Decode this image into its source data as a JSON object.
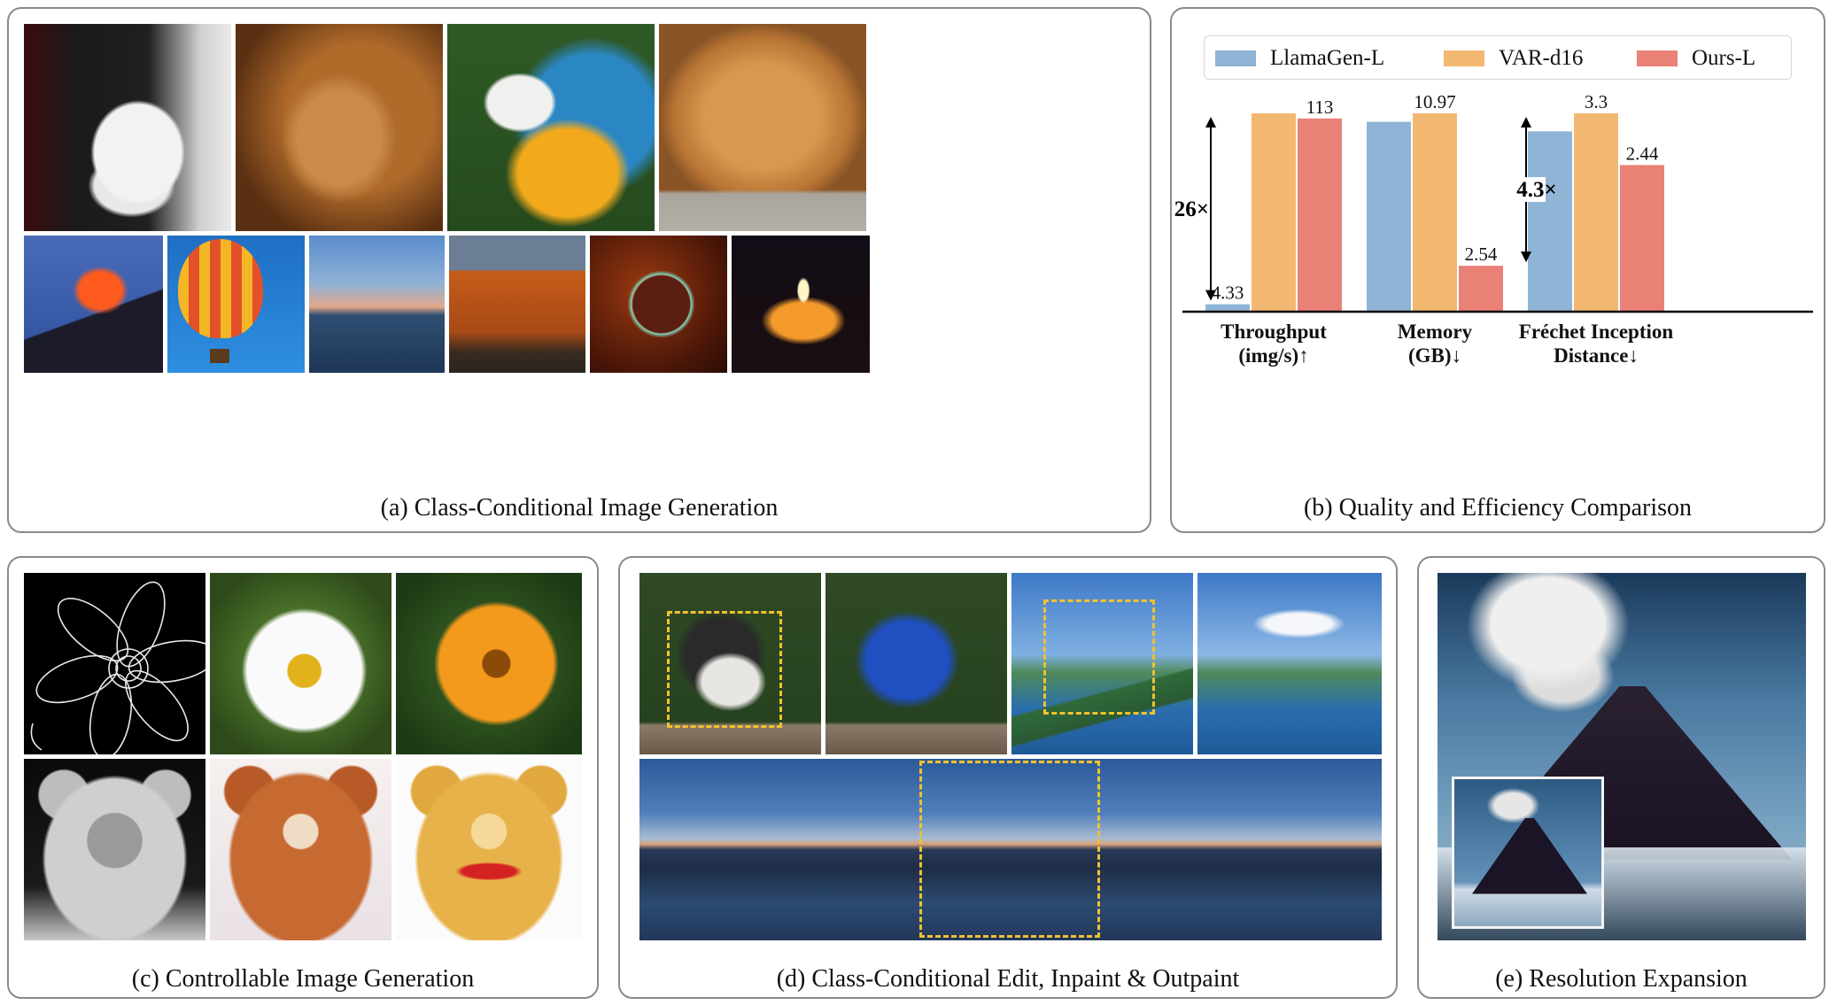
{
  "panels": {
    "a": {
      "caption": "(a) Class-Conditional Image Generation"
    },
    "b": {
      "caption": "(b) Quality and Efficiency Comparison"
    },
    "c": {
      "caption": "(c) Controllable Image Generation"
    },
    "d": {
      "caption": "(d) Class-Conditional Edit, Inpaint & Outpaint"
    },
    "e": {
      "caption": "(e) Resolution Expansion"
    }
  },
  "colors": {
    "llamagen": "#8fb4d6",
    "var": "#f2b872",
    "ours": "#ea8176",
    "dashed_box": "#f2c12e"
  },
  "images": {
    "a_top": [
      "husky-photo",
      "lion-photo",
      "macaw-photo",
      "golden-retriever-photo"
    ],
    "a_bottom": [
      "volcano-photo",
      "hot-air-balloon-photo",
      "sea-sunset-photo",
      "cliff-photo",
      "soap-bubble-photo",
      "candle-photo"
    ],
    "c": [
      "flower-edge-map",
      "white-daisy-photo",
      "orange-flower-photo",
      "teddy-depth-map",
      "brown-teddy-photo",
      "yellow-teddy-photo"
    ],
    "d_top": [
      "junco-bird-photo",
      "blue-bird-photo",
      "mountain-lake-photo",
      "mountain-lake-edited-photo"
    ],
    "d_bottom": "panoramic-lake-photo",
    "e": [
      "volcano-highres-photo",
      "volcano-lowres-inset"
    ]
  },
  "chart_data": {
    "type": "bar",
    "categories": [
      "Throughput\n(img/s)↑",
      "Memory\n(GB)↓",
      "Fréchet Inception\nDistance↓"
    ],
    "category_lines": [
      [
        "Throughput",
        "(img/s)↑"
      ],
      [
        "Memory",
        "(GB)↓"
      ],
      [
        "Fréchet Inception",
        "Distance↓"
      ]
    ],
    "series": [
      {
        "name": "LlamaGen-L",
        "values": [
          4.33,
          10.5,
          3.0
        ]
      },
      {
        "name": "VAR-d16",
        "values": [
          116,
          10.97,
          3.3
        ]
      },
      {
        "name": "Ours-L",
        "values": [
          113,
          2.54,
          2.44
        ]
      }
    ],
    "value_labels": [
      {
        "category": 0,
        "series": 0,
        "text": "4.33"
      },
      {
        "category": 0,
        "series": 2,
        "text": "113"
      },
      {
        "category": 1,
        "series": 1,
        "text": "10.97"
      },
      {
        "category": 1,
        "series": 2,
        "text": "2.54"
      },
      {
        "category": 2,
        "series": 1,
        "text": "3.3"
      },
      {
        "category": 2,
        "series": 2,
        "text": "2.44"
      }
    ],
    "annotations": [
      {
        "text": "26×",
        "category": 0,
        "from_series": 0,
        "to_series": 1
      },
      {
        "text": "4.3×",
        "category": 1,
        "from_series": 2,
        "to_series": 1
      }
    ],
    "legend_position": "top",
    "axes_visible": false,
    "grid": false
  }
}
